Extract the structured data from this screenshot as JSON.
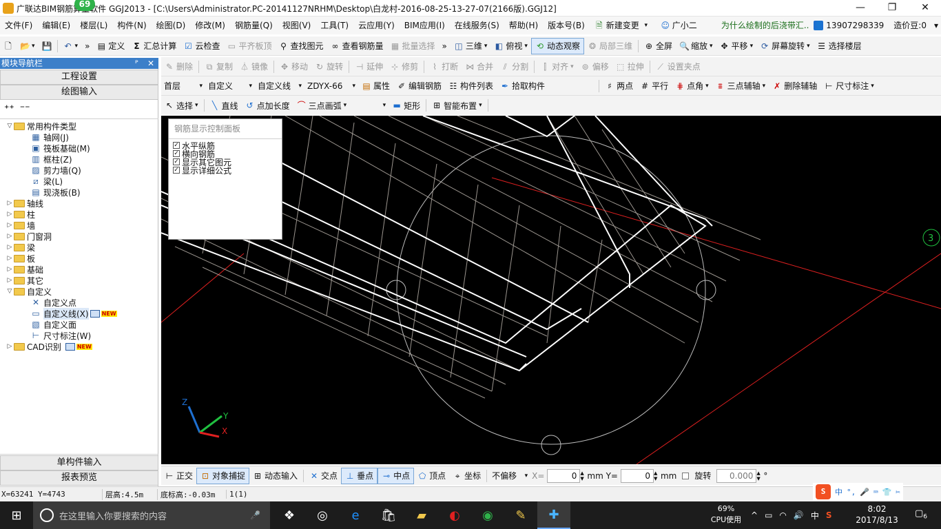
{
  "titlebar": {
    "title": "广联达BIM钢筋算量软件 GGJ2013 - [C:\\Users\\Administrator.PC-20141127NRHM\\Desktop\\白龙村-2016-08-25-13-27-07(2166版).GGJ12]",
    "badge": "69",
    "minimize": "—",
    "maximize": "❐",
    "close": "✕"
  },
  "menubar": {
    "items": [
      "文件(F)",
      "编辑(E)",
      "楼层(L)",
      "构件(N)",
      "绘图(D)",
      "修改(M)",
      "钢筋量(Q)",
      "视图(V)",
      "工具(T)",
      "云应用(Y)",
      "BIM应用(I)",
      "在线服务(S)",
      "帮助(H)",
      "版本号(B)"
    ],
    "new_change": "新建变更",
    "assistant": "广小二",
    "hint": "为什么绘制的后浇带汇...",
    "phone": "13907298339",
    "price": "造价豆:0"
  },
  "toolbar1": {
    "define": "定义",
    "sum": "汇总计算",
    "cloud_check": "云检查",
    "flush_slab": "平齐板顶",
    "find": "查找图元",
    "view_rebar": "查看钢筋量",
    "batch_select": "批量选择",
    "three_d": "三维",
    "top_view": "俯视",
    "dynamic": "动态观察",
    "local_3d": "局部三维",
    "fullscreen": "全屏",
    "zoom": "缩放",
    "pan": "平移",
    "rotate": "屏幕旋转",
    "select_floor": "选择楼层"
  },
  "toolbar2": {
    "items": [
      "删除",
      "复制",
      "镜像",
      "移动",
      "旋转",
      "延伸",
      "修剪",
      "打断",
      "合并",
      "分割",
      "对齐",
      "偏移",
      "拉伸",
      "设置夹点"
    ]
  },
  "toolbar3": {
    "floor": "首层",
    "category": "自定义",
    "type": "自定义线",
    "component": "ZDYX-66",
    "props": "属性",
    "edit_rebar": "编辑钢筋",
    "list": "构件列表",
    "pick": "拾取构件",
    "two_points": "两点",
    "parallel": "平行",
    "point_angle": "点角",
    "three_aux": "三点辅轴",
    "del_aux": "删除辅轴",
    "dim": "尺寸标注"
  },
  "toolbar4": {
    "select": "选择",
    "line": "直线",
    "add_length": "点加长度",
    "arc": "三点画弧",
    "rect": "矩形",
    "smart": "智能布置"
  },
  "nav": {
    "header": "模块导航栏",
    "pin": "ᴾ",
    "close": "✕",
    "project_settings": "工程设置",
    "drawing_input": "绘图输入",
    "tree": {
      "common_types": "常用构件类型",
      "common_children": [
        {
          "icon": "grid-icon",
          "glyph": "▦",
          "label": "轴网(J)"
        },
        {
          "icon": "raft-icon",
          "glyph": "▣",
          "label": "筏板基础(M)"
        },
        {
          "icon": "column-icon",
          "glyph": "▥",
          "label": "框柱(Z)"
        },
        {
          "icon": "wall-icon",
          "glyph": "▨",
          "label": "剪力墙(Q)"
        },
        {
          "icon": "beam-icon",
          "glyph": "⧄",
          "label": "梁(L)"
        },
        {
          "icon": "slab-icon",
          "glyph": "▤",
          "label": "现浇板(B)"
        }
      ],
      "groups": [
        "轴线",
        "柱",
        "墙",
        "门窗洞",
        "梁",
        "板",
        "基础",
        "其它"
      ],
      "custom": "自定义",
      "custom_children": [
        {
          "icon": "custom-point-icon",
          "glyph": "✕",
          "label": "自定义点"
        },
        {
          "icon": "custom-line-icon",
          "glyph": "▭",
          "label": "自定义线(X)",
          "new": true
        },
        {
          "icon": "custom-face-icon",
          "glyph": "▧",
          "label": "自定义面"
        },
        {
          "icon": "dimension-icon",
          "glyph": "⊢",
          "label": "尺寸标注(W)"
        }
      ],
      "cad": "CAD识别",
      "new_badge": "NEW"
    },
    "single_input": "单构件输入",
    "report": "报表预览"
  },
  "panel": {
    "title": "钢筋显示控制面板",
    "options": [
      {
        "label": "水平纵筋",
        "checked": true
      },
      {
        "label": "横向钢筋",
        "checked": true
      },
      {
        "label": "显示其它图元",
        "checked": true
      },
      {
        "label": "显示详细公式",
        "checked": true
      }
    ]
  },
  "canvas": {
    "axis_badge": "3",
    "axis_x": "X",
    "axis_y": "Y",
    "axis_z": "Z"
  },
  "bottombar": {
    "ortho": "正交",
    "snap": "对象捕捉",
    "dyn_input": "动态输入",
    "intersect": "交点",
    "perp": "垂点",
    "mid": "中点",
    "vertex": "顶点",
    "coord": "坐标",
    "offset_mode": "不偏移",
    "x_label": "X=",
    "x_val": "0",
    "y_label": "mm Y=",
    "y_val": "0",
    "mm": "mm",
    "rotate": "旋转",
    "rotate_val": "0.000",
    "deg": "°"
  },
  "status": {
    "coords": "X=63241 Y=4743",
    "floor_height": "层高:4.5m",
    "base_height": "底标高:-0.03m",
    "count": "1(1)"
  },
  "ime": {
    "items": [
      "中",
      "°,",
      "🎤",
      "⌨",
      "👕",
      "✂"
    ]
  },
  "taskbar": {
    "search_placeholder": "在这里输入你要搜索的内容",
    "cpu_pct": "69%",
    "cpu_label": "CPU使用",
    "lang": "中",
    "time": "8:02",
    "date": "2017/8/13",
    "notif": "6"
  },
  "colors": {
    "nav_header": "#3c7fc9",
    "canvas_bg": "#000000",
    "axis_red": "#e02020",
    "axis_green": "#20c040"
  }
}
